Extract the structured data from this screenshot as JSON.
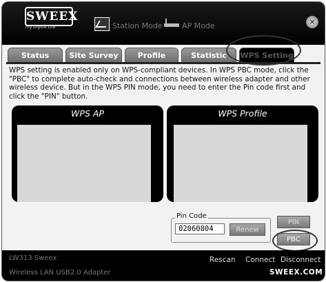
{
  "app": {
    "logo_text": "SWEEX",
    "tagline": "my Digital Life",
    "close_symbol": "×"
  },
  "modes": {
    "station": "Station Mode",
    "ap": "AP Mode"
  },
  "tabs": [
    {
      "label": "Status"
    },
    {
      "label": "Site Survey"
    },
    {
      "label": "Profile"
    },
    {
      "label": "Statistic"
    },
    {
      "label": "WPS Setting",
      "active": true
    }
  ],
  "description": "WPS setting is enabled only on WPS-compliant devices. In WPS PBC mode, click the \"PBC\" to complete auto-check and connections between wireless adapter and other wireless device. But in the WPS PIN mode, you need to enter the Pin code first and click the \"PIN\" button.",
  "panels": {
    "wps_ap": "WPS AP",
    "wps_profile": "WPS Profile"
  },
  "pin": {
    "label": "Pin Code",
    "value": "02060804",
    "renew": "Renew",
    "pin_button": "PIN",
    "pbc_button": "PBC"
  },
  "statusbar": {
    "device": "LW313 Sweex",
    "adapter": "Wireless LAN USB2.0 Adapter",
    "rescan": "Rescan",
    "connect": "Connect",
    "disconnect": "Disconnect",
    "brand": "SWEEX.COM"
  }
}
